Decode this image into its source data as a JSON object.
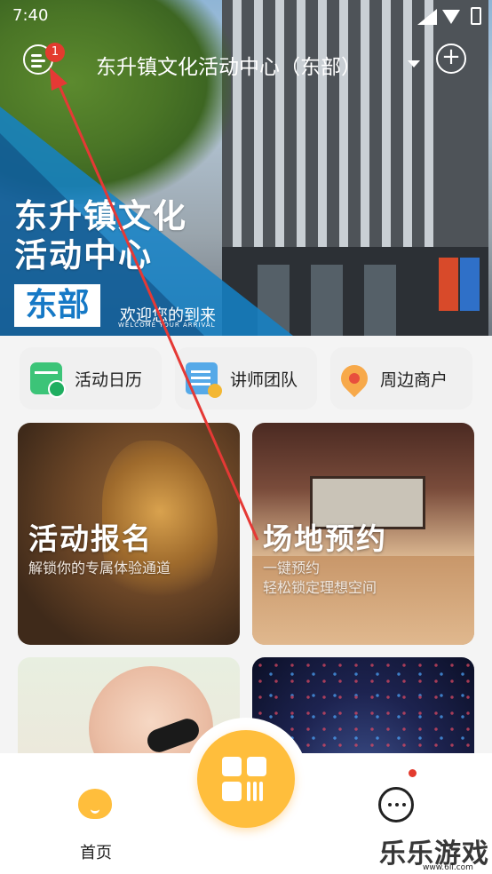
{
  "status_bar": {
    "time": "7:40"
  },
  "header": {
    "notification_count": "1",
    "site_name": "东升镇文化活动中心（东部）",
    "add_symbol": "+"
  },
  "hero": {
    "title_line1": "东升镇文化",
    "title_line2": "活动中心",
    "badge": "东部",
    "welcome": "欢迎您的到来",
    "welcome_en": "WELCOME YOUR ARRIVAL"
  },
  "quick_links": [
    {
      "label": "活动日历",
      "icon": "calendar-icon"
    },
    {
      "label": "讲师团队",
      "icon": "team-icon"
    },
    {
      "label": "周边商户",
      "icon": "location-pin-icon"
    }
  ],
  "cards": [
    {
      "title": "活动报名",
      "subtitle1": "解锁你的专属体验通道",
      "subtitle2": ""
    },
    {
      "title": "场地预约",
      "subtitle1": "一键预约",
      "subtitle2": "轻松锁定理想空间"
    },
    {
      "title": "",
      "subtitle1": "",
      "subtitle2": ""
    },
    {
      "title": "",
      "subtitle1": "",
      "subtitle2": ""
    }
  ],
  "bottom_nav": {
    "home_label": "首页",
    "center_icon": "grid-app-icon",
    "message_icon": "message-icon"
  },
  "watermark": {
    "text": "乐乐游戏",
    "url": "www.6ll.com"
  },
  "colors": {
    "accent": "#ffbe3c",
    "hero_blue": "#1679c6",
    "badge_red": "#e33b2e",
    "annotation_arrow": "#e53935"
  }
}
